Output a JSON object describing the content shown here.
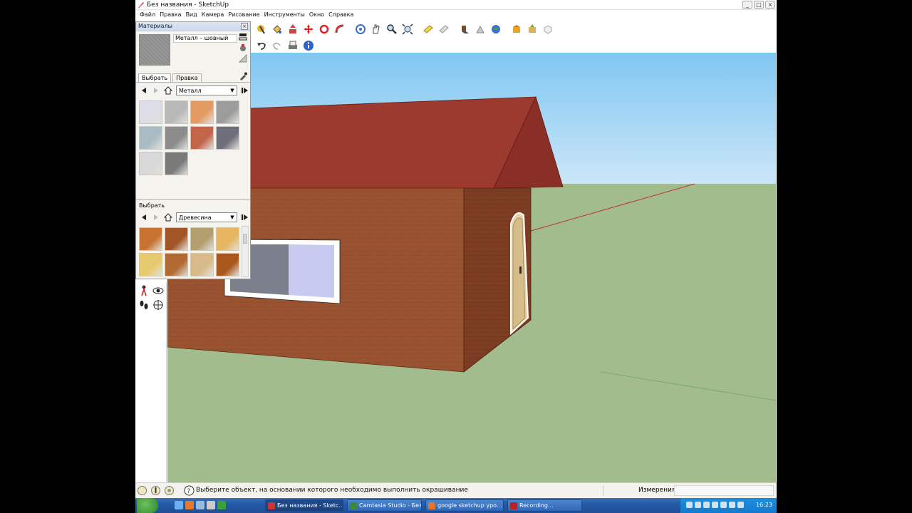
{
  "window": {
    "title": "Без названия - SketchUp",
    "controls": [
      "_",
      "□",
      "×"
    ]
  },
  "menu": [
    "Файл",
    "Правка",
    "Вид",
    "Камера",
    "Рисование",
    "Инструменты",
    "Окно",
    "Справка"
  ],
  "toolbar": {
    "row1_icons": [
      "select-icon",
      "paint-bucket-icon",
      "push-pull-icon",
      "move-icon",
      "rotate-icon",
      "follow-me-icon",
      "orbit-icon",
      "pan-icon",
      "zoom-icon",
      "zoom-extents-icon",
      "section-plane-icon",
      "section-display-icon",
      "shadow-icon",
      "fog-icon",
      "google-earth-icon",
      "get-models-icon",
      "share-model-icon",
      "components-icon"
    ],
    "row2_icons": [
      "undo-icon",
      "redo-icon",
      "print-icon",
      "model-info-icon"
    ]
  },
  "materials": {
    "title": "Материалы",
    "current_material": "Металл – шовный",
    "tabs": [
      "Выбрать",
      "Правка"
    ],
    "active_tab": "Выбрать",
    "upper_collection": "Металл",
    "lower_label": "Выбрать",
    "lower_collection": "Древесина",
    "upper_swatches": [
      "#dcdde6",
      "#b9b9b9",
      "#e29c63",
      "#9c9c9c",
      "#a9bcc3",
      "#8c8c8c",
      "#c2654a",
      "#6e6f7a",
      "#d8d8d8",
      "#7a7a7a"
    ],
    "lower_swatches": [
      "#c7722e",
      "#a25526",
      "#b39e70",
      "#e6b561",
      "#e7ca6d",
      "#b06a32",
      "#d7b98a",
      "#a9571c"
    ]
  },
  "statusbar": {
    "hint": "Выберите объект, на основании которого необходимо выполнить окрашивание",
    "measurements_label": "Измерения",
    "measurements_value": ""
  },
  "taskbar": {
    "tasks": [
      {
        "label": "Без названия - Sketc...",
        "color": "#c33"
      },
      {
        "label": "Camtasia Studio - Без ...",
        "color": "#3a8a3a"
      },
      {
        "label": "google sketchup уро...",
        "color": "#e2752a"
      },
      {
        "label": "Recording...",
        "color": "#b22"
      }
    ],
    "clock": "16:23"
  },
  "scene": {
    "sky_color": "#9fd2f3",
    "ground_color": "#a2bc8e",
    "roof_color": "#9c3a30",
    "wall_color": "#9a5330",
    "wall_side_color": "#7d3d22"
  }
}
